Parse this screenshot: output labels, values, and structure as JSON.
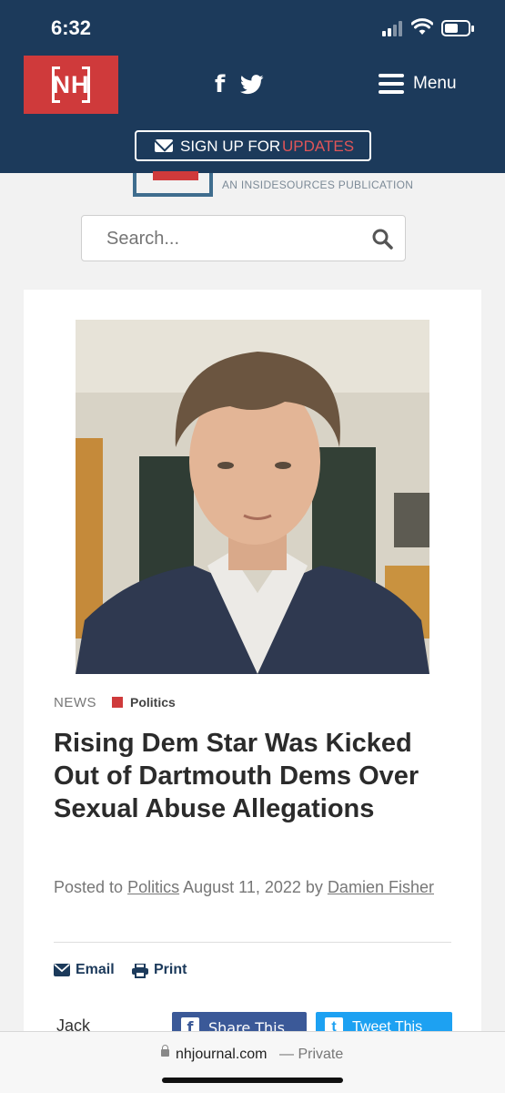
{
  "status_bar": {
    "time": "6:32",
    "battery_level": 0.6
  },
  "header": {
    "logo_text": "NH",
    "menu_label": "Menu",
    "signup": {
      "prefix": "SIGN UP FOR",
      "highlight": "UPDATES"
    },
    "accent_color": "#cf3a3b",
    "bg_color": "#1c3a5b"
  },
  "site": {
    "tagline": "AN INSIDESOURCES PUBLICATION"
  },
  "search": {
    "placeholder": "Search..."
  },
  "article": {
    "category": "NEWS",
    "tag": "Politics",
    "headline": "Rising Dem Star Was Kicked Out of Dartmouth Dems Over Sexual Abuse Allegations",
    "byline": {
      "posted_to": "Posted to",
      "section_link": "Politics",
      "date": "August 11, 2022",
      "by": "by",
      "author": "Damien Fisher"
    },
    "actions": {
      "email": "Email",
      "print": "Print"
    },
    "author_peek": "Jack",
    "share": {
      "facebook": "Share This",
      "twitter": "Tweet This"
    }
  },
  "browser": {
    "domain": "nhjournal.com",
    "mode": "— Private"
  }
}
